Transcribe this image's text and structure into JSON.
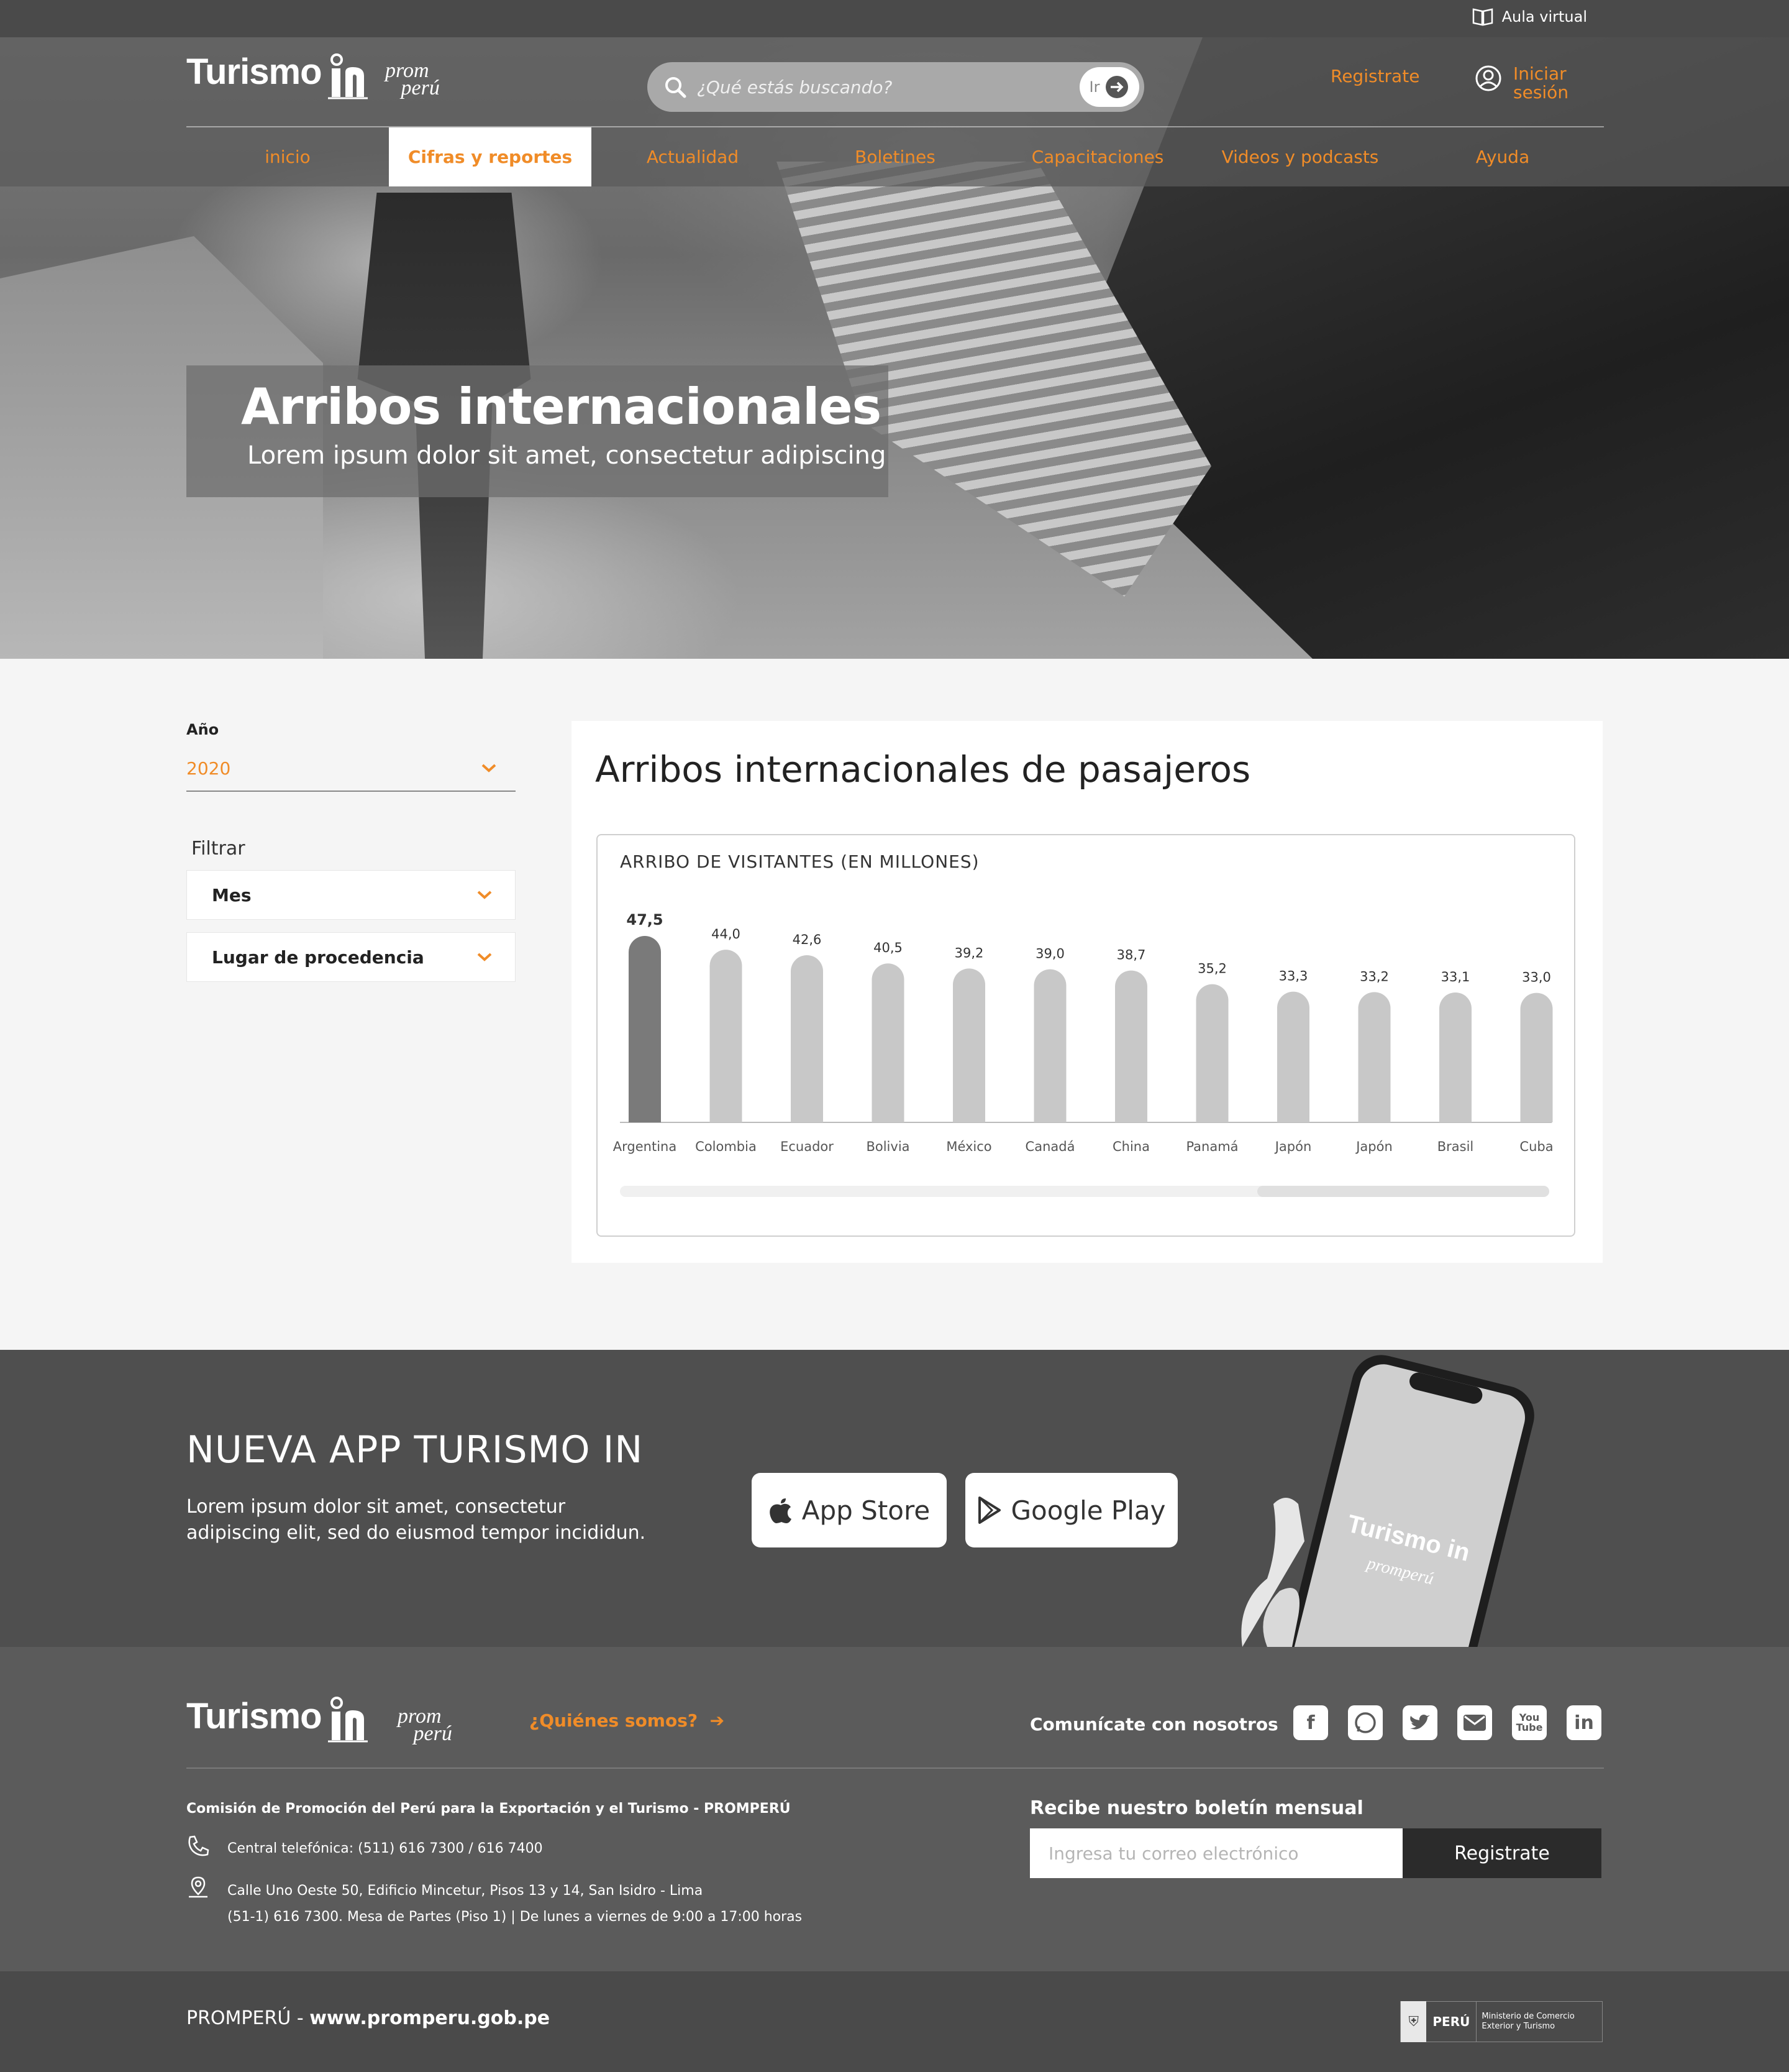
{
  "topbar": {
    "aula_virtual": "Aula virtual"
  },
  "header": {
    "logo_turismo": "Turismo",
    "logo_prom": "prom",
    "logo_peru": "perú",
    "search_placeholder": "¿Qué estás buscando?",
    "search_go": "Ir",
    "register": "Registrate",
    "login": "Iniciar sesión"
  },
  "nav": {
    "items": [
      {
        "label": "inicio",
        "active": false
      },
      {
        "label": "Cifras y reportes",
        "active": true
      },
      {
        "label": "Actualidad",
        "active": false
      },
      {
        "label": "Boletines",
        "active": false
      },
      {
        "label": "Capacitaciones",
        "active": false
      },
      {
        "label": "Videos y podcasts",
        "active": false
      },
      {
        "label": "Ayuda",
        "active": false
      }
    ]
  },
  "hero": {
    "title": "Arribos internacionales",
    "subtitle": "Lorem ipsum dolor sit amet, consectetur adipiscing"
  },
  "filters": {
    "year_label": "Año",
    "year_value": "2020",
    "filter_label": "Filtrar",
    "month": "Mes",
    "origin": "Lugar de procedencia"
  },
  "card": {
    "title": "Arribos internacionales de pasajeros"
  },
  "chart_data": {
    "type": "bar",
    "title": "ARRIBO DE VISITANTES (EN MILLONES)",
    "categories": [
      "Argentina",
      "Colombia",
      "Ecuador",
      "Bolivia",
      "México",
      "Canadá",
      "China",
      "Panamá",
      "Japón",
      "Japón",
      "Brasil",
      "Cuba"
    ],
    "values": [
      47.5,
      44.0,
      42.6,
      40.5,
      39.2,
      39.0,
      38.7,
      35.2,
      33.3,
      33.2,
      33.1,
      33.0
    ],
    "value_labels": [
      "47,5",
      "44,0",
      "42,6",
      "40,5",
      "39,2",
      "39,0",
      "38,7",
      "35,2",
      "33,3",
      "33,2",
      "33,1",
      "33,0"
    ],
    "highlight_index": 0,
    "colors": {
      "highlight": "#7a7a7a",
      "default": "#c8c8c8"
    },
    "grid": false,
    "legend": "none"
  },
  "app": {
    "title": "NUEVA APP TURISMO IN",
    "description": "Lorem ipsum dolor sit amet, consectetur adipiscing elit, sed do eiusmod tempor incididun.",
    "app_store": "App Store",
    "google_play": "Google Play"
  },
  "footer": {
    "logo_turismo": "Turismo",
    "logo_prom": "prom",
    "logo_peru": "perú",
    "quienes": "¿Quiénes somos?",
    "contact_label": "Comunícate con nosotros",
    "social": [
      "facebook-icon",
      "whatsapp-icon",
      "twitter-icon",
      "mail-icon",
      "youtube-icon",
      "linkedin-icon"
    ],
    "commission": "Comisión de Promoción del Perú para la Exportación y el Turismo - PROMPERÚ",
    "phone": "Central telefónica: (511) 616 7300 / 616 7400",
    "address_line1": "Calle Uno Oeste 50, Edificio Mincetur, Pisos 13 y 14, San Isidro - Lima",
    "address_line2": "(51-1) 616 7300. Mesa de Partes (Piso 1) | De lunes a viernes de 9:00 a 17:00 horas",
    "newsletter_title": "Recibe nuestro boletín mensual",
    "email_placeholder": "Ingresa tu correo electrónico",
    "newsletter_button": "Registrate"
  },
  "bottom": {
    "site_prefix": "PROMPERÚ - ",
    "site_url": "www.promperu.gob.pe",
    "gov_peru": "PERÚ",
    "gov_ministry": "Ministerio de Comercio Exterior y Turismo"
  },
  "accent_color": "#f08c28"
}
